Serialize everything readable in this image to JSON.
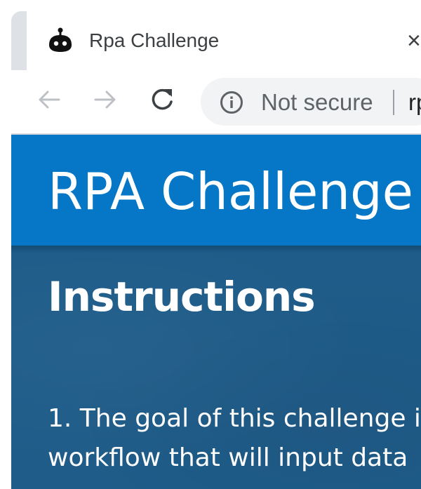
{
  "browser": {
    "tab": {
      "title": "Rpa Challenge",
      "favicon": "robot-icon",
      "close_icon": "close-icon",
      "close_glyph": "×"
    },
    "toolbar": {
      "back_icon": "back-arrow-icon",
      "forward_icon": "forward-arrow-icon",
      "reload_icon": "reload-icon",
      "security_icon": "info-icon",
      "security_label": "Not secure",
      "url_visible": "rp"
    }
  },
  "page": {
    "header_title": "RPA Challenge",
    "instructions_heading": "Instructions",
    "instruction_lines": [
      "1. The goal of this challenge i",
      "workflow that will input data"
    ]
  },
  "colors": {
    "header_blue": "#0577c6",
    "content_blue": "#1f5c89",
    "omnibox_bg": "#f1f3f4"
  }
}
